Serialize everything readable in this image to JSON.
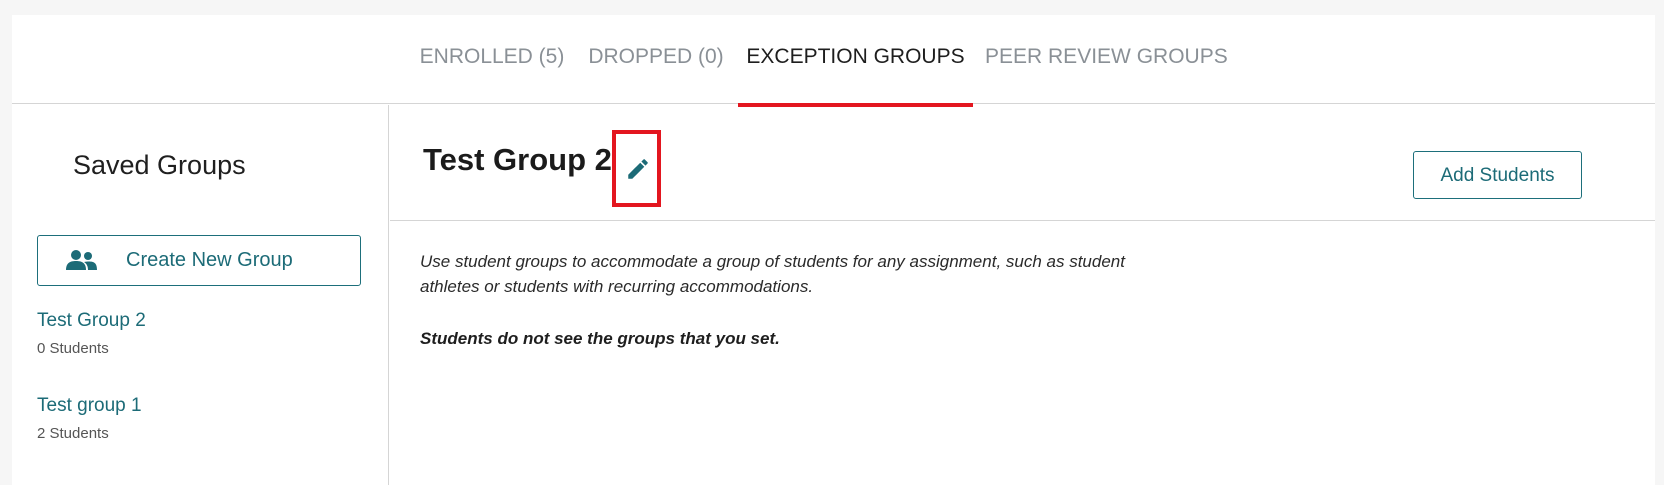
{
  "tabs": [
    {
      "label": "ENROLLED (5)",
      "active": false
    },
    {
      "label": "DROPPED (0)",
      "active": false
    },
    {
      "label": "EXCEPTION GROUPS",
      "active": true
    },
    {
      "label": "PEER REVIEW GROUPS",
      "active": false
    }
  ],
  "sidebar": {
    "title": "Saved Groups",
    "create_button": {
      "label": "Create New Group",
      "icon": "users-icon"
    },
    "groups": [
      {
        "name": "Test Group 2",
        "count": "0 Students"
      },
      {
        "name": "Test group 1",
        "count": "2 Students"
      }
    ]
  },
  "main": {
    "title": "Test Group 2",
    "edit_icon": "pencil-icon",
    "add_button": "Add Students",
    "description": "Use student groups to accommodate a group of students for any assignment, such as student athletes or students with recurring accommodations.",
    "note": "Students do not see the groups that you set."
  },
  "colors": {
    "accent": "#1c6b77",
    "active_tab_underline": "#e3161f",
    "highlight_box": "#e3161f",
    "inactive_tab": "#8a9096"
  }
}
